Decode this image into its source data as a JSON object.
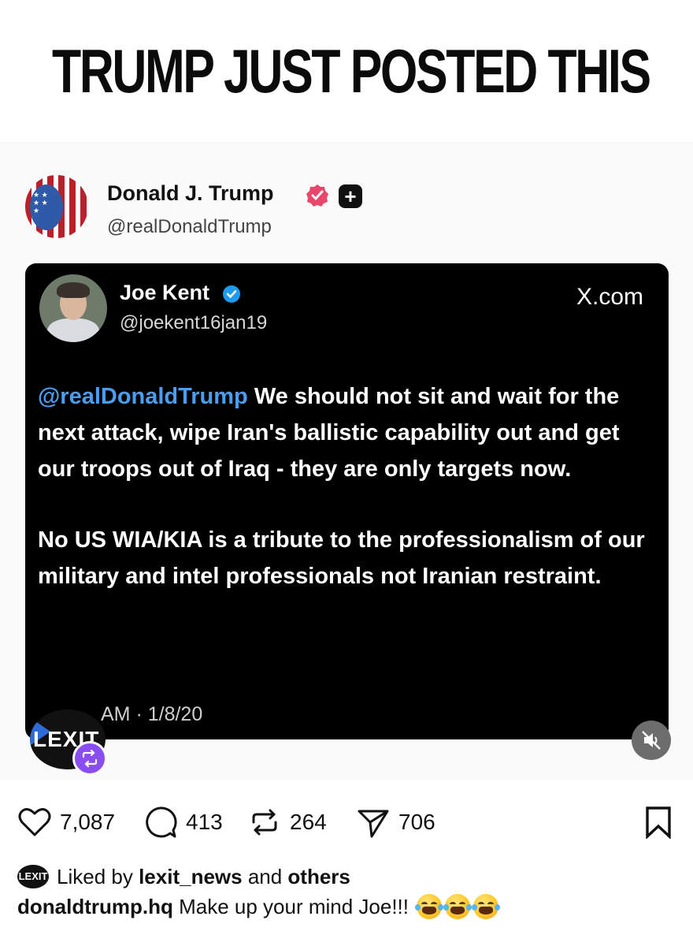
{
  "banner": {
    "text": "TRUMP JUST POSTED THIS",
    "emoji": "tears-of-joy-emoji"
  },
  "post": {
    "author_name": "Donald J. Trump",
    "author_handle": "@realDonaldTrump",
    "badges": [
      "verified-badge-icon",
      "plus-badge-icon"
    ]
  },
  "embedded_tweet": {
    "name": "Joe Kent",
    "handle": "@joekent16jan19",
    "source": "X.com",
    "mention": "@realDonaldTrump",
    "paragraph1_rest": " We should not sit and wait for the next attack, wipe Iran's ballistic capability out and get our troops out of Iraq - they are only targets now.",
    "paragraph2": "No US WIA/KIA is a tribute to the professionalism of our military and intel professionals not Iranian restraint.",
    "timestamp": "AM · 1/8/20"
  },
  "overlay": {
    "logo_text": "LEXIT"
  },
  "actions": {
    "likes": "7,087",
    "comments": "413",
    "reposts": "264",
    "shares": "706"
  },
  "liked_by": {
    "prefix": "Liked by ",
    "user": "lexit_news",
    "middle": " and ",
    "others": "others",
    "avatar_text": "LEXIT"
  },
  "caption": {
    "user": "donaldtrump.hq",
    "text": " Make up your mind Joe!!!"
  },
  "colors": {
    "mention_blue": "#4a9df0",
    "card_bg": "#000000",
    "pink_badge": "#e8466a",
    "blue_badge": "#1d9bf0",
    "repost_purple": "#8a4df0"
  }
}
